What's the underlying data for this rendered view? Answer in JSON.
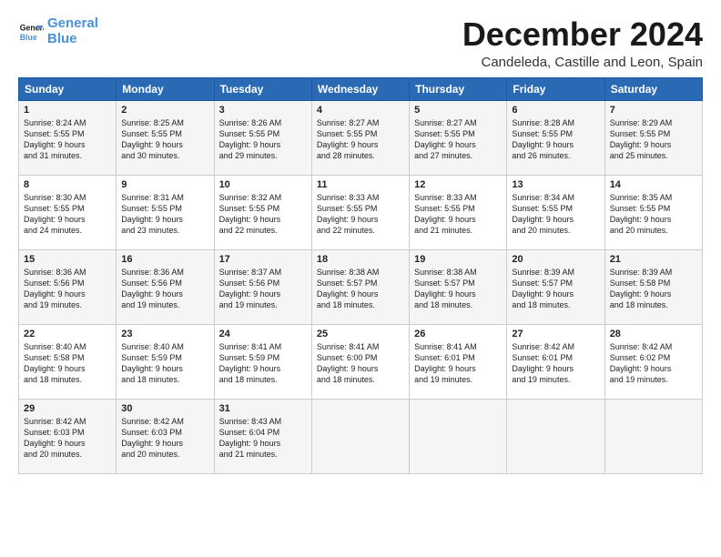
{
  "logo": {
    "line1": "General",
    "line2": "Blue"
  },
  "title": "December 2024",
  "location": "Candeleda, Castille and Leon, Spain",
  "header": {
    "days": [
      "Sunday",
      "Monday",
      "Tuesday",
      "Wednesday",
      "Thursday",
      "Friday",
      "Saturday"
    ]
  },
  "weeks": [
    [
      {
        "day": "1",
        "text": "Sunrise: 8:24 AM\nSunset: 5:55 PM\nDaylight: 9 hours\nand 31 minutes."
      },
      {
        "day": "2",
        "text": "Sunrise: 8:25 AM\nSunset: 5:55 PM\nDaylight: 9 hours\nand 30 minutes."
      },
      {
        "day": "3",
        "text": "Sunrise: 8:26 AM\nSunset: 5:55 PM\nDaylight: 9 hours\nand 29 minutes."
      },
      {
        "day": "4",
        "text": "Sunrise: 8:27 AM\nSunset: 5:55 PM\nDaylight: 9 hours\nand 28 minutes."
      },
      {
        "day": "5",
        "text": "Sunrise: 8:27 AM\nSunset: 5:55 PM\nDaylight: 9 hours\nand 27 minutes."
      },
      {
        "day": "6",
        "text": "Sunrise: 8:28 AM\nSunset: 5:55 PM\nDaylight: 9 hours\nand 26 minutes."
      },
      {
        "day": "7",
        "text": "Sunrise: 8:29 AM\nSunset: 5:55 PM\nDaylight: 9 hours\nand 25 minutes."
      }
    ],
    [
      {
        "day": "8",
        "text": "Sunrise: 8:30 AM\nSunset: 5:55 PM\nDaylight: 9 hours\nand 24 minutes."
      },
      {
        "day": "9",
        "text": "Sunrise: 8:31 AM\nSunset: 5:55 PM\nDaylight: 9 hours\nand 23 minutes."
      },
      {
        "day": "10",
        "text": "Sunrise: 8:32 AM\nSunset: 5:55 PM\nDaylight: 9 hours\nand 22 minutes."
      },
      {
        "day": "11",
        "text": "Sunrise: 8:33 AM\nSunset: 5:55 PM\nDaylight: 9 hours\nand 22 minutes."
      },
      {
        "day": "12",
        "text": "Sunrise: 8:33 AM\nSunset: 5:55 PM\nDaylight: 9 hours\nand 21 minutes."
      },
      {
        "day": "13",
        "text": "Sunrise: 8:34 AM\nSunset: 5:55 PM\nDaylight: 9 hours\nand 20 minutes."
      },
      {
        "day": "14",
        "text": "Sunrise: 8:35 AM\nSunset: 5:55 PM\nDaylight: 9 hours\nand 20 minutes."
      }
    ],
    [
      {
        "day": "15",
        "text": "Sunrise: 8:36 AM\nSunset: 5:56 PM\nDaylight: 9 hours\nand 19 minutes."
      },
      {
        "day": "16",
        "text": "Sunrise: 8:36 AM\nSunset: 5:56 PM\nDaylight: 9 hours\nand 19 minutes."
      },
      {
        "day": "17",
        "text": "Sunrise: 8:37 AM\nSunset: 5:56 PM\nDaylight: 9 hours\nand 19 minutes."
      },
      {
        "day": "18",
        "text": "Sunrise: 8:38 AM\nSunset: 5:57 PM\nDaylight: 9 hours\nand 18 minutes."
      },
      {
        "day": "19",
        "text": "Sunrise: 8:38 AM\nSunset: 5:57 PM\nDaylight: 9 hours\nand 18 minutes."
      },
      {
        "day": "20",
        "text": "Sunrise: 8:39 AM\nSunset: 5:57 PM\nDaylight: 9 hours\nand 18 minutes."
      },
      {
        "day": "21",
        "text": "Sunrise: 8:39 AM\nSunset: 5:58 PM\nDaylight: 9 hours\nand 18 minutes."
      }
    ],
    [
      {
        "day": "22",
        "text": "Sunrise: 8:40 AM\nSunset: 5:58 PM\nDaylight: 9 hours\nand 18 minutes."
      },
      {
        "day": "23",
        "text": "Sunrise: 8:40 AM\nSunset: 5:59 PM\nDaylight: 9 hours\nand 18 minutes."
      },
      {
        "day": "24",
        "text": "Sunrise: 8:41 AM\nSunset: 5:59 PM\nDaylight: 9 hours\nand 18 minutes."
      },
      {
        "day": "25",
        "text": "Sunrise: 8:41 AM\nSunset: 6:00 PM\nDaylight: 9 hours\nand 18 minutes."
      },
      {
        "day": "26",
        "text": "Sunrise: 8:41 AM\nSunset: 6:01 PM\nDaylight: 9 hours\nand 19 minutes."
      },
      {
        "day": "27",
        "text": "Sunrise: 8:42 AM\nSunset: 6:01 PM\nDaylight: 9 hours\nand 19 minutes."
      },
      {
        "day": "28",
        "text": "Sunrise: 8:42 AM\nSunset: 6:02 PM\nDaylight: 9 hours\nand 19 minutes."
      }
    ],
    [
      {
        "day": "29",
        "text": "Sunrise: 8:42 AM\nSunset: 6:03 PM\nDaylight: 9 hours\nand 20 minutes."
      },
      {
        "day": "30",
        "text": "Sunrise: 8:42 AM\nSunset: 6:03 PM\nDaylight: 9 hours\nand 20 minutes."
      },
      {
        "day": "31",
        "text": "Sunrise: 8:43 AM\nSunset: 6:04 PM\nDaylight: 9 hours\nand 21 minutes."
      },
      {
        "day": "",
        "text": ""
      },
      {
        "day": "",
        "text": ""
      },
      {
        "day": "",
        "text": ""
      },
      {
        "day": "",
        "text": ""
      }
    ]
  ]
}
